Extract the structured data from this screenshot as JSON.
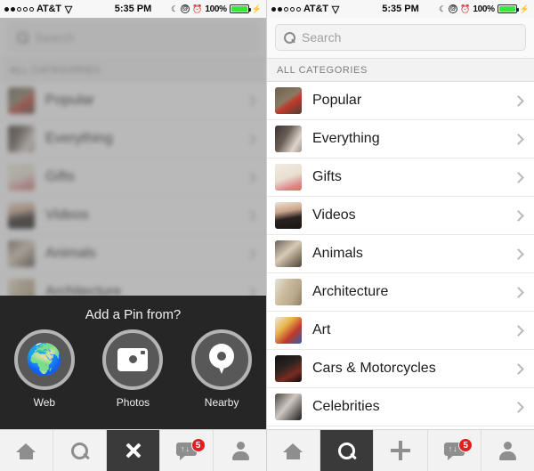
{
  "status_bar": {
    "signal_dots_filled": 2,
    "signal_dots_total": 5,
    "carrier": "AT&T",
    "wifi_icon": "wifi-icon",
    "time": "5:35 PM",
    "moon_icon": "moon-icon",
    "orientation_lock_icon": "at-symbol-icon",
    "alarm_icon": "alarm-clock-icon",
    "battery_percent": "100%",
    "battery_icon": "battery-full-icon",
    "charging_icon": "lightning-bolt-icon"
  },
  "search": {
    "placeholder": "Search",
    "icon": "search-icon"
  },
  "section_header": "ALL CATEGORIES",
  "categories": [
    {
      "label": "Popular",
      "thumb_colors": [
        "#6c5f4e",
        "#c0392b"
      ]
    },
    {
      "label": "Everything",
      "thumb_colors": [
        "#3a3330",
        "#ded6cc"
      ]
    },
    {
      "label": "Gifts",
      "thumb_colors": [
        "#e8ded0",
        "#d98a8a"
      ]
    },
    {
      "label": "Videos",
      "thumb_colors": [
        "#2a2220",
        "#c9a38a"
      ]
    },
    {
      "label": "Animals",
      "thumb_colors": [
        "#6b6258",
        "#d8cbb6"
      ]
    },
    {
      "label": "Architecture",
      "thumb_colors": [
        "#b9a88c",
        "#e7e2d8"
      ]
    },
    {
      "label": "Art",
      "thumb_colors": [
        "#efe9e4",
        "#c0392b"
      ]
    },
    {
      "label": "Cars & Motorcycles",
      "thumb_colors": [
        "#121212",
        "#7a2b22"
      ]
    },
    {
      "label": "Celebrities",
      "thumb_colors": [
        "#4a4644",
        "#cfc8c2"
      ]
    }
  ],
  "chevron_icon": "chevron-right-icon",
  "add_pin_sheet": {
    "title": "Add a Pin from?",
    "options": [
      {
        "label": "Web",
        "icon": "globe-icon"
      },
      {
        "label": "Photos",
        "icon": "camera-icon"
      },
      {
        "label": "Nearby",
        "icon": "map-pin-icon"
      }
    ]
  },
  "tab_bar_left": {
    "tabs": [
      {
        "name": "home",
        "icon": "home-icon",
        "active": false,
        "badge": ""
      },
      {
        "name": "search",
        "icon": "search-icon",
        "active": false,
        "badge": ""
      },
      {
        "name": "close",
        "icon": "close-x-icon",
        "active": true,
        "badge": ""
      },
      {
        "name": "messages",
        "icon": "message-bubble-icon",
        "active": false,
        "badge": "5"
      },
      {
        "name": "profile",
        "icon": "person-icon",
        "active": false,
        "badge": ""
      }
    ]
  },
  "tab_bar_right": {
    "tabs": [
      {
        "name": "home",
        "icon": "home-icon",
        "active": false,
        "badge": ""
      },
      {
        "name": "search",
        "icon": "search-icon",
        "active": true,
        "badge": ""
      },
      {
        "name": "add",
        "icon": "plus-icon",
        "active": false,
        "badge": ""
      },
      {
        "name": "messages",
        "icon": "message-bubble-icon",
        "active": false,
        "badge": "5"
      },
      {
        "name": "profile",
        "icon": "person-icon",
        "active": false,
        "badge": ""
      }
    ]
  },
  "colors": {
    "badge_red": "#e02020",
    "active_tab_dark": "#3a3a3a",
    "sheet_background": "#262626",
    "battery_green": "#39e639"
  }
}
